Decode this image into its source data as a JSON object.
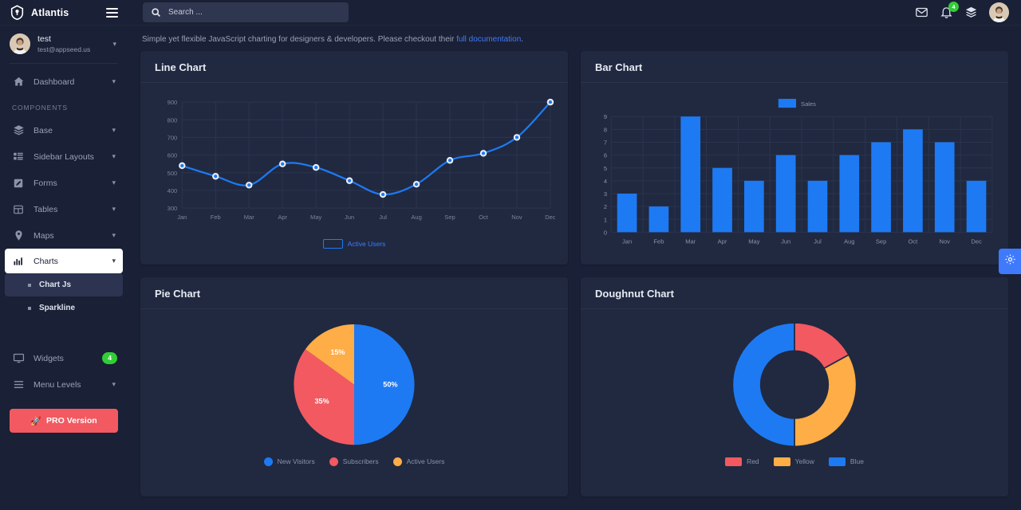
{
  "brand": {
    "name": "Atlantis",
    "logo_icon": "shield-logo-icon",
    "menu_icon": "hamburger-icon"
  },
  "user": {
    "name": "test",
    "email": "test@appseed.us",
    "caret_icon": "caret-down-icon",
    "avatar_icon": "user-avatar"
  },
  "sidebar": {
    "section_label": "COMPONENTS",
    "top_items": [
      {
        "label": "Dashboard",
        "icon": "home-icon",
        "caret": true
      }
    ],
    "items": [
      {
        "label": "Base",
        "icon": "layers-icon",
        "caret": true
      },
      {
        "label": "Sidebar Layouts",
        "icon": "list-grid-icon",
        "caret": true
      },
      {
        "label": "Forms",
        "icon": "pencil-square-icon",
        "caret": true
      },
      {
        "label": "Tables",
        "icon": "table-icon",
        "caret": true
      },
      {
        "label": "Maps",
        "icon": "map-pin-icon",
        "caret": true
      },
      {
        "label": "Charts",
        "icon": "bar-chart-icon",
        "caret": true,
        "active": true
      }
    ],
    "sub_items": [
      {
        "label": "Chart Js",
        "current": true
      },
      {
        "label": "Sparkline",
        "current": false
      }
    ],
    "bottom_items": [
      {
        "label": "Widgets",
        "icon": "monitor-icon",
        "badge": "4"
      },
      {
        "label": "Menu Levels",
        "icon": "menu-lines-icon",
        "caret": true
      }
    ],
    "pro_button": {
      "label": "PRO Version",
      "icon": "rocket-icon"
    }
  },
  "topbar": {
    "search": {
      "placeholder": "Search ...",
      "value": "",
      "icon": "search-icon"
    },
    "icons": [
      {
        "name": "envelope-icon"
      },
      {
        "name": "bell-icon",
        "badge": "4"
      },
      {
        "name": "layers-stack-icon"
      }
    ],
    "avatar": "user-avatar"
  },
  "page": {
    "lead_text_1": "Simple yet flexible JavaScript charting for designers & developers. Please checkout their ",
    "lead_link": "full documentation",
    "lead_text_2": "."
  },
  "settings_fab": {
    "icon": "gear-icon"
  },
  "colors": {
    "blue": "#1d7af3",
    "red": "#f25961",
    "yellow": "#ffad46",
    "green": "#31ce36",
    "card_bg": "#202940",
    "page_bg": "#1a2035",
    "grid": "#2b344e"
  },
  "cards": {
    "line": {
      "title": "Line Chart"
    },
    "bar": {
      "title": "Bar Chart"
    },
    "pie": {
      "title": "Pie Chart"
    },
    "doughnut": {
      "title": "Doughnut Chart"
    }
  },
  "chart_data": [
    {
      "id": "line",
      "type": "line",
      "title": "Line Chart",
      "categories": [
        "Jan",
        "Feb",
        "Mar",
        "Apr",
        "May",
        "Jun",
        "Jul",
        "Aug",
        "Sep",
        "Oct",
        "Nov",
        "Dec"
      ],
      "series": [
        {
          "name": "Active Users",
          "color": "#1d7af3",
          "values": [
            540,
            480,
            430,
            550,
            530,
            455,
            377,
            435,
            570,
            610,
            700,
            900
          ]
        }
      ],
      "yticks": [
        900,
        800,
        700,
        600,
        500,
        400,
        300
      ],
      "ylim": [
        300,
        900
      ],
      "xlabel": "",
      "ylabel": "",
      "grid": true,
      "legend": {
        "position": "bottom",
        "style": "outline-box",
        "entries": [
          "Active Users"
        ]
      }
    },
    {
      "id": "bar",
      "type": "bar",
      "title": "Bar Chart",
      "categories": [
        "Jan",
        "Feb",
        "Mar",
        "Apr",
        "May",
        "Jun",
        "Jul",
        "Aug",
        "Sep",
        "Oct",
        "Nov",
        "Dec"
      ],
      "series": [
        {
          "name": "Sales",
          "color": "#1d7af3",
          "values": [
            3,
            2,
            9,
            5,
            4,
            6,
            4,
            6,
            7,
            8,
            7,
            4
          ]
        }
      ],
      "yticks": [
        9,
        8,
        7,
        6,
        5,
        4,
        3,
        2,
        1,
        0
      ],
      "ylim": [
        0,
        9
      ],
      "xlabel": "",
      "ylabel": "",
      "grid": true,
      "legend": {
        "position": "top",
        "entries": [
          "Sales"
        ]
      }
    },
    {
      "id": "pie",
      "type": "pie",
      "title": "Pie Chart",
      "labels": [
        "New Visitors",
        "Subscribers",
        "Active Users"
      ],
      "values": [
        50,
        35,
        15
      ],
      "data_labels": [
        "50%",
        "35%",
        "15%"
      ],
      "colors": [
        "#1d7af3",
        "#f25961",
        "#ffad46"
      ],
      "legend": {
        "position": "bottom",
        "style": "dot"
      }
    },
    {
      "id": "doughnut",
      "type": "pie",
      "title": "Doughnut Chart",
      "labels": [
        "Red",
        "Yellow",
        "Blue"
      ],
      "values": [
        17,
        33,
        50
      ],
      "colors": [
        "#f25961",
        "#ffad46",
        "#1d7af3"
      ],
      "legend": {
        "position": "bottom",
        "style": "box"
      }
    }
  ]
}
